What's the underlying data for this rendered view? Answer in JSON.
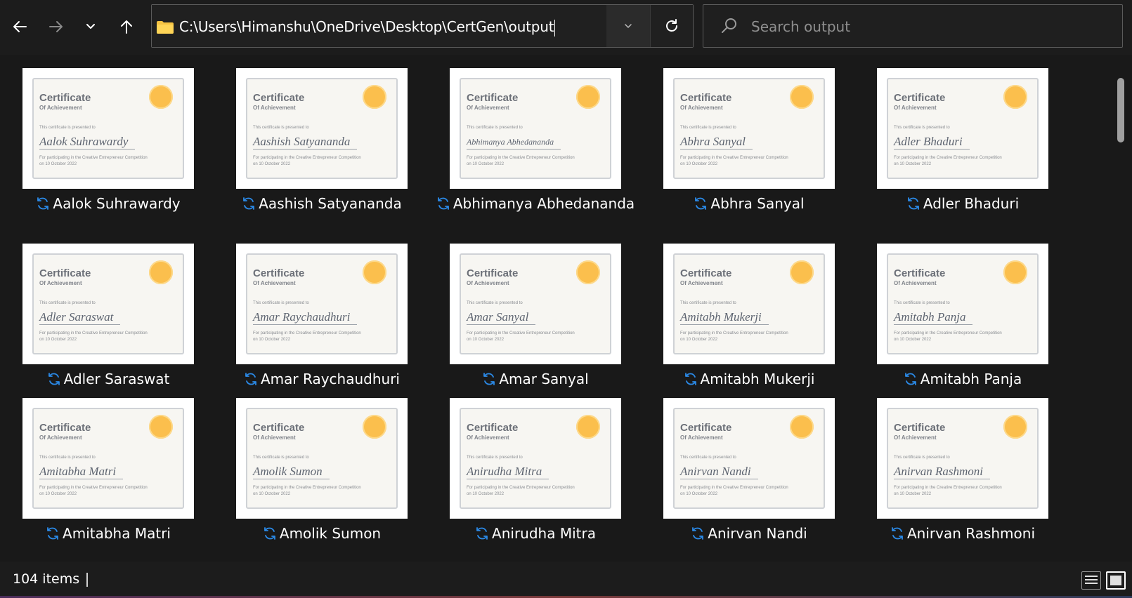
{
  "window": {
    "address_path": "C:\\Users\\Himanshu\\OneDrive\\Desktop\\CertGen\\output",
    "search_placeholder": "Search output",
    "nav": {
      "back": "back-arrow-icon",
      "forward": "forward-arrow-icon",
      "recent": "chevron-down-icon",
      "up": "up-arrow-icon"
    },
    "colors": {
      "background": "#191919",
      "folder": "#f5c342",
      "sync_icon": "#2b8ae8",
      "seal": "#fbbf4d"
    }
  },
  "certificate_template": {
    "title": "Certificate",
    "subtitle": "Of Achievement",
    "presented": "This certificate is presented to",
    "desc_line1": "For participating in the Creative Entrepreneur Competition",
    "desc_line2": "on 10 October 2022"
  },
  "files": [
    {
      "label": "Aalok Suhrawardy",
      "cert_name": "Aalok Suhrawardy"
    },
    {
      "label": "Aashish Satyananda",
      "cert_name": "Aashish Satyananda"
    },
    {
      "label": "Abhimanya Abhedananda",
      "cert_name": "Abhimanya Abhedananda"
    },
    {
      "label": "Abhra Sanyal",
      "cert_name": "Abhra Sanyal"
    },
    {
      "label": "Adler Bhaduri",
      "cert_name": "Adler Bhaduri"
    },
    {
      "label": "Adler Saraswat",
      "cert_name": "Adler Saraswat"
    },
    {
      "label": "Amar Raychaudhuri",
      "cert_name": "Amar Raychaudhuri"
    },
    {
      "label": "Amar Sanyal",
      "cert_name": "Amar Sanyal"
    },
    {
      "label": "Amitabh Mukerji",
      "cert_name": "Amitabh Mukerji"
    },
    {
      "label": "Amitabh Panja",
      "cert_name": "Amitabh Panja"
    },
    {
      "label": "Amitabha Matri",
      "cert_name": "Amitabha Matri"
    },
    {
      "label": "Amolik Sumon",
      "cert_name": "Amolik Sumon"
    },
    {
      "label": "Anirudha Mitra",
      "cert_name": "Anirudha Mitra"
    },
    {
      "label": "Anirvan Nandi",
      "cert_name": "Anirvan Nandi"
    },
    {
      "label": "Anirvan Rashmoni",
      "cert_name": "Anirvan Rashmoni"
    }
  ],
  "status": {
    "item_count": "104 items"
  }
}
